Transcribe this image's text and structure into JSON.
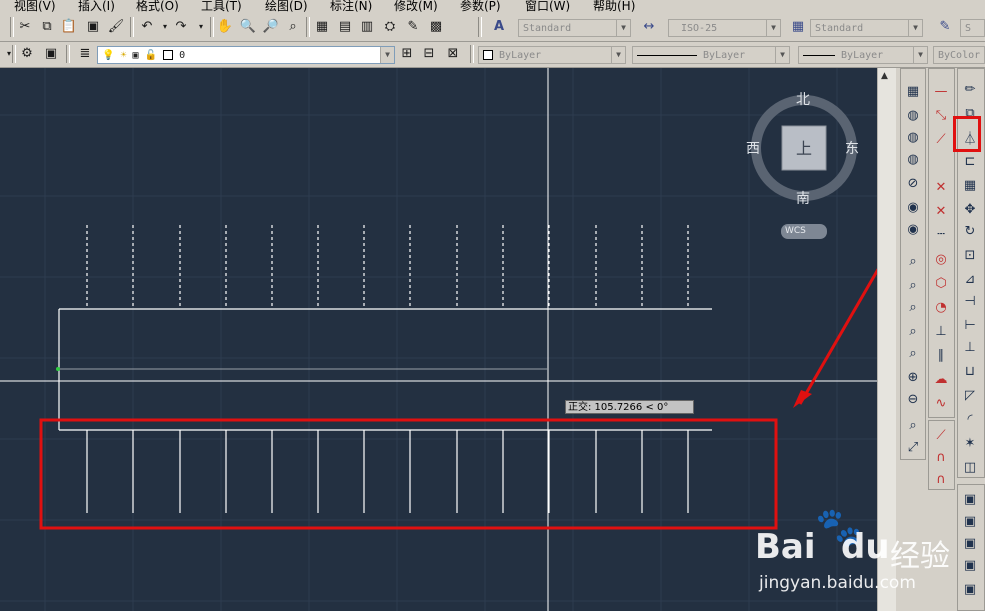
{
  "menubar": {
    "items": [
      "视图(V)",
      "插入(I)",
      "格式(O)",
      "工具(T)",
      "绘图(D)",
      "标注(N)",
      "修改(M)",
      "参数(P)",
      "窗口(W)",
      "帮助(H)"
    ]
  },
  "toolbar1": {
    "text_style": "Standard",
    "dim_style": "ISO-25",
    "table_style": "Standard",
    "extra": "S"
  },
  "toolbar2": {
    "layer_value": "0",
    "color_value": "ByLayer",
    "linetype_value": "ByLayer",
    "lineweight_value": "ByLayer",
    "plotstyle_value": "ByColor"
  },
  "viewcube": {
    "north": "北",
    "south": "南",
    "east": "东",
    "west": "西",
    "face": "上",
    "coord_system": "WCS"
  },
  "tooltip": {
    "text": "正交: 105.7266 < 0°"
  },
  "watermark": {
    "brand": "Bai",
    "brand2": "du",
    "product": "经验",
    "url": "jingyan.baidu.com"
  },
  "colors": {
    "canvas_bg": "#233041",
    "highlight_red": "#e01010",
    "geometry": "#ffffff"
  }
}
